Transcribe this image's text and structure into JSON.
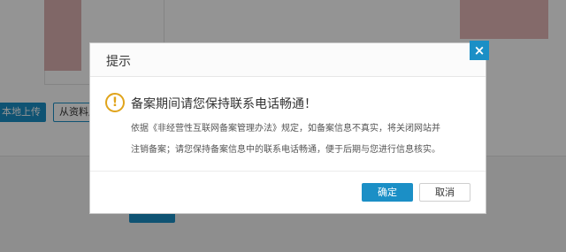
{
  "background": {
    "upload_button_label": "本地上传",
    "library_button_label": "从资料库",
    "next_button_label": ""
  },
  "dialog": {
    "title": "提示",
    "close_icon": "×",
    "warning_icon": "!",
    "message_title": "备案期间请您保持联系电话畅通！",
    "message_line_1": "依据《非经营性互联网备案管理办法》规定，如备案信息不真实，将关闭网站并",
    "message_line_2": "注销备案；请您保持备案信息中的联系电话畅通，便于后期与您进行信息核实。",
    "confirm_label": "确定",
    "cancel_label": "取消"
  },
  "colors": {
    "accent": "#1b8fc6",
    "warning": "#e0a41c"
  }
}
